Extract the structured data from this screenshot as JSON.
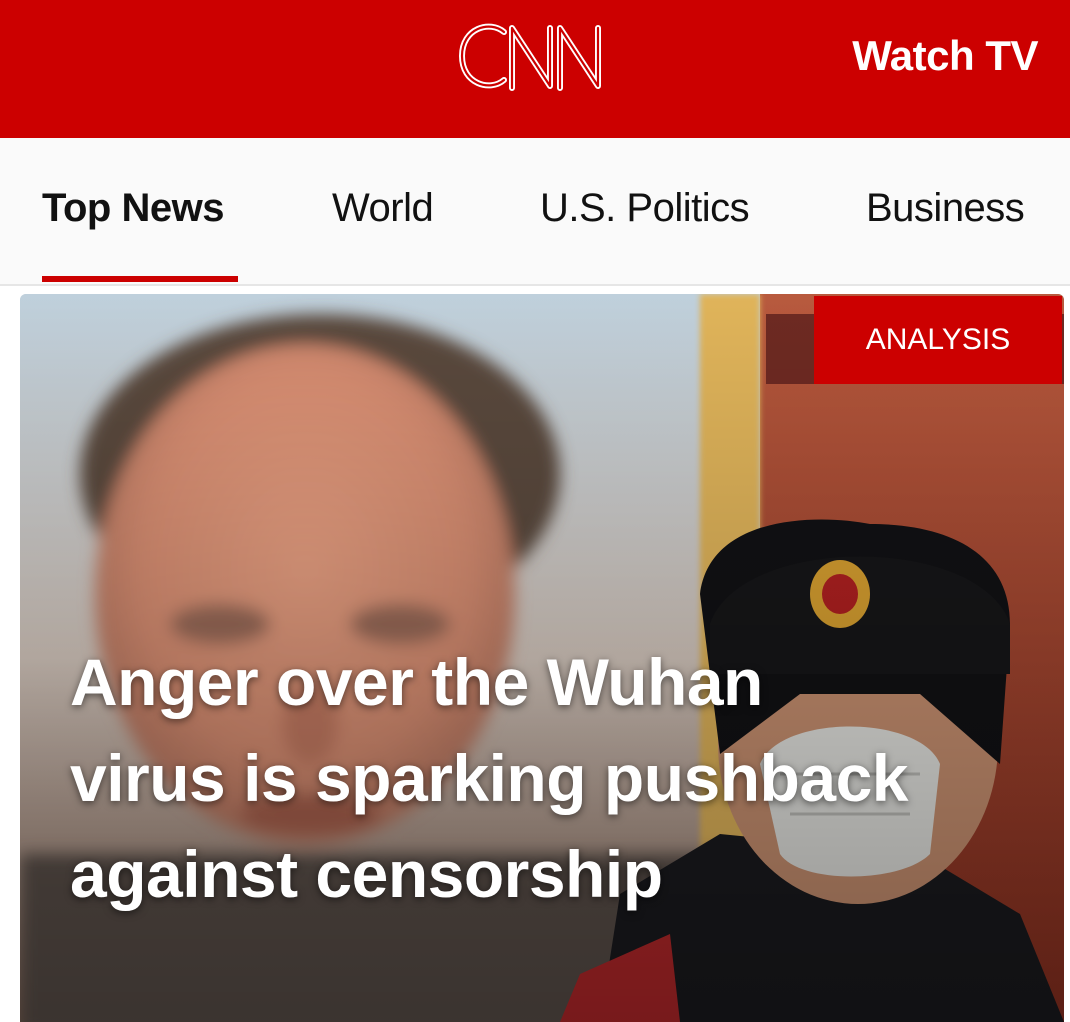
{
  "header": {
    "logo_text": "CNN",
    "watch_tv_label": "Watch TV",
    "brand_color": "#cc0000"
  },
  "nav": {
    "items": [
      {
        "label": "Top News",
        "active": true
      },
      {
        "label": "World",
        "active": false
      },
      {
        "label": "U.S. Politics",
        "active": false
      },
      {
        "label": "Business",
        "active": false
      }
    ]
  },
  "story": {
    "badge": "ANALYSIS",
    "headline": "Anger over the Wuhan virus is sparking pushback against censorship"
  }
}
